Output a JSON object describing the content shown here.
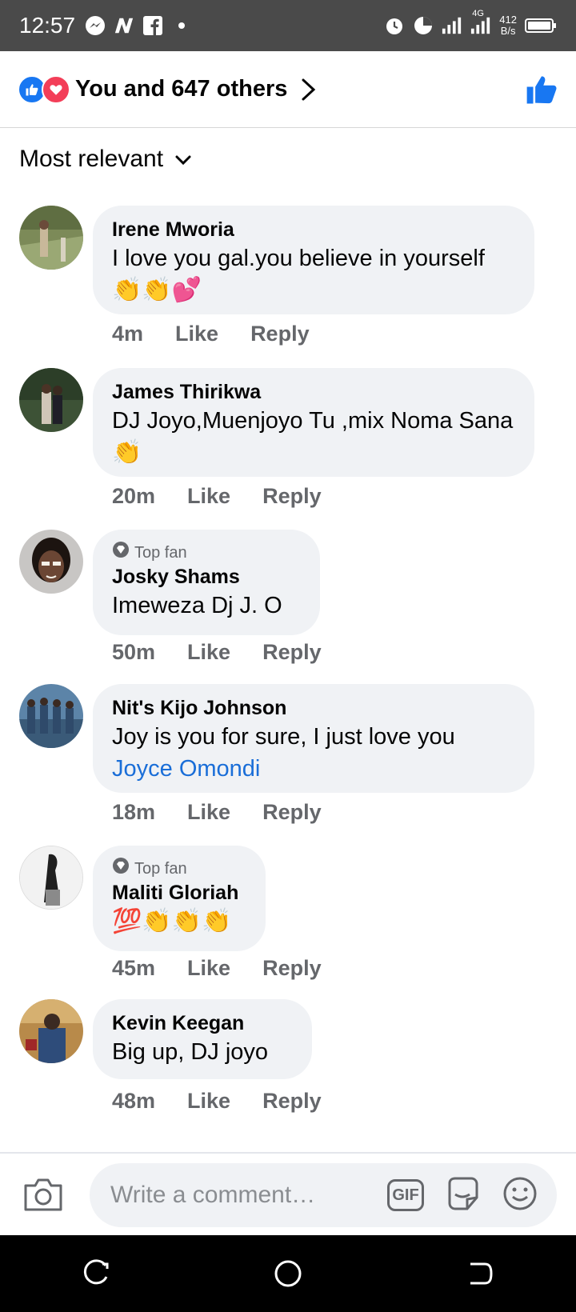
{
  "status_bar": {
    "time": "12:57",
    "left_icons": [
      "messenger-icon",
      "n-app-icon",
      "facebook-icon",
      "dot-icon"
    ],
    "right_icons": [
      "alarm-icon",
      "data-saver-icon",
      "signal-icon",
      "signal-4g-icon",
      "battery-icon"
    ],
    "net_speed_value": "412",
    "net_speed_unit": "B/s",
    "network_type": "4G"
  },
  "header": {
    "reaction_icons": [
      "like-reaction-icon",
      "love-reaction-icon"
    ],
    "summary": "You and 647 others",
    "like_button_icon": "thumbs-up-icon",
    "colors": {
      "like": "#1877f2",
      "love": "#f33e58"
    }
  },
  "sort": {
    "label": "Most relevant"
  },
  "comments": [
    {
      "author": "Irene Mworia",
      "text": "I love you gal.you believe in yourself",
      "emoji": "👏👏💕",
      "time": "4m",
      "like": "Like",
      "reply": "Reply",
      "top_fan": false
    },
    {
      "author": "James Thirikwa",
      "text": "DJ Joyo,Muenjoyo Tu ,mix Noma Sana",
      "emoji": "👏",
      "time": "20m",
      "like": "Like",
      "reply": "Reply",
      "top_fan": false
    },
    {
      "author": "Josky Shams",
      "badge": "Top fan",
      "text": "Imeweza Dj J. O",
      "time": "50m",
      "like": "Like",
      "reply": "Reply",
      "top_fan": true
    },
    {
      "author": "Nit's Kijo Johnson",
      "text": "Joy is you  for sure, I just love you",
      "mention": "Joyce Omondi",
      "time": "18m",
      "like": "Like",
      "reply": "Reply",
      "top_fan": false
    },
    {
      "author": "Maliti Gloriah",
      "badge": "Top fan",
      "emoji": "💯👏👏👏",
      "time": "45m",
      "like": "Like",
      "reply": "Reply",
      "top_fan": true
    },
    {
      "author": "Kevin Keegan",
      "text": "Big up,  DJ joyo",
      "time": "48m",
      "like": "Like",
      "reply": "Reply",
      "top_fan": false
    }
  ],
  "composer": {
    "placeholder": "Write a comment…",
    "icons": [
      "camera-icon",
      "gif-icon",
      "sticker-icon",
      "emoji-icon"
    ],
    "gif_label": "GIF"
  },
  "nav_bar": {
    "icons": [
      "recents-icon",
      "home-icon",
      "back-icon"
    ]
  }
}
